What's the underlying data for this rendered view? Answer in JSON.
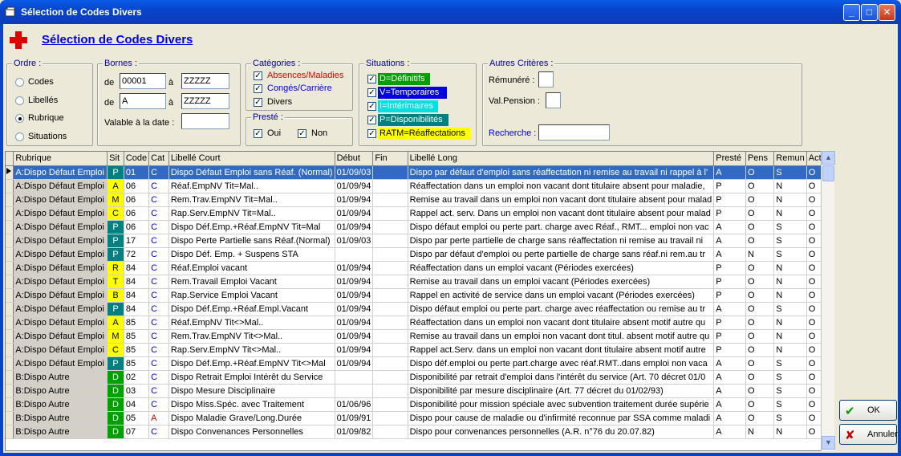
{
  "window": {
    "title": "Sélection de Codes Divers"
  },
  "header": {
    "title": "Sélection de Codes Divers"
  },
  "ordre": {
    "legend": "Ordre :",
    "options": [
      "Codes",
      "Libellés",
      "Rubrique",
      "Situations"
    ],
    "selected": "Rubrique"
  },
  "bornes": {
    "legend": "Bornes :",
    "de_label": "de",
    "a_label": "à",
    "row1_from": "00001",
    "row1_to": "ZZZZZ",
    "row2_from": "A",
    "row2_to": "ZZZZZ",
    "valable_label": "Valable à la date :",
    "valable_value": ""
  },
  "categories": {
    "legend": "Catégories :",
    "items": [
      {
        "label": "Absences/Maladies",
        "checked": true,
        "color": "#e00000"
      },
      {
        "label": "Congés/Carrière",
        "checked": true,
        "color": "#0000e0"
      },
      {
        "label": "Divers",
        "checked": true,
        "color": "#000000"
      }
    ]
  },
  "preste": {
    "legend": "Presté :",
    "items": [
      {
        "label": "Oui",
        "checked": true
      },
      {
        "label": "Non",
        "checked": true
      }
    ]
  },
  "situations": {
    "legend": "Situations :",
    "items": [
      {
        "label": "D=Définitifs",
        "checked": true,
        "bg": "#00a000",
        "fg": "#ffffff"
      },
      {
        "label": "V=Temporaires",
        "checked": true,
        "bg": "#0000e0",
        "fg": "#ffffff"
      },
      {
        "label": "I=Intérimaires",
        "checked": true,
        "bg": "#00e0e0",
        "fg": "#ffffff"
      },
      {
        "label": "P=Disponibilités",
        "checked": true,
        "bg": "#008080",
        "fg": "#ffffff"
      },
      {
        "label": "RATM=Réaffectations",
        "checked": true,
        "bg": "#ffff00",
        "fg": "#000000"
      }
    ]
  },
  "autres": {
    "legend": "Autres Critères :",
    "remunere_label": "Rémunéré :",
    "remunere_value": "",
    "pension_label": "Val.Pension :",
    "pension_value": "",
    "recherche_label": "Recherche :",
    "recherche_value": ""
  },
  "sit_colors": {
    "P": "#008080",
    "A": "#ffff00",
    "M": "#ffff00",
    "C": "#ffff00",
    "R": "#ffff00",
    "T": "#ffff00",
    "B": "#ffff00",
    "D": "#00a000"
  },
  "cat_colors": {
    "C": "#0000e0",
    "A": "#e00000"
  },
  "table": {
    "columns": [
      "Rubrique",
      "Sit",
      "Code",
      "Cat",
      "Libellé Court",
      "Début",
      "Fin",
      "Libellé Long",
      "Presté",
      "Pens",
      "Remun",
      "Actif"
    ],
    "rows": [
      [
        "A:Dispo Défaut Emploi",
        "P",
        "01",
        "C",
        "Dispo Défaut Emploi sans Réaf. (Normal)",
        "01/09/03",
        "",
        "Dispo par défaut d'emploi sans réaffectation ni remise au travail ni rappel à l'",
        "A",
        "O",
        "S",
        "O"
      ],
      [
        "A:Dispo Défaut Emploi",
        "A",
        "06",
        "C",
        "Réaf.EmpNV Tit=Mal..",
        "01/09/94",
        "",
        "Réaffectation dans un emploi non vacant dont titulaire absent pour maladie,",
        "P",
        "O",
        "N",
        "O"
      ],
      [
        "A:Dispo Défaut Emploi",
        "M",
        "06",
        "C",
        "Rem.Trav.EmpNV Tit=Mal..",
        "01/09/94",
        "",
        "Remise au travail dans un emploi non vacant dont titulaire absent pour malad",
        "P",
        "O",
        "N",
        "O"
      ],
      [
        "A:Dispo Défaut Emploi",
        "C",
        "06",
        "C",
        "Rap.Serv.EmpNV Tit=Mal..",
        "01/09/94",
        "",
        "Rappel act. serv. Dans un emploi non vacant dont titulaire absent pour malad",
        "P",
        "O",
        "N",
        "O"
      ],
      [
        "A:Dispo Défaut Emploi",
        "P",
        "06",
        "C",
        "Dispo Déf.Emp.+Réaf.EmpNV Tit=Mal",
        "01/09/94",
        "",
        "Dispo défaut emploi ou perte part. charge avec Réaf., RMT... emploi non vac",
        "A",
        "O",
        "S",
        "O"
      ],
      [
        "A:Dispo Défaut Emploi",
        "P",
        "17",
        "C",
        "Dispo Perte Partielle sans Réaf.(Normal)",
        "01/09/03",
        "",
        "Dispo par perte partielle de charge sans réaffectation ni remise au travail ni",
        "A",
        "O",
        "S",
        "O"
      ],
      [
        "A:Dispo Défaut Emploi",
        "P",
        "72",
        "C",
        "Dispo Déf. Emp. + Suspens STA",
        "",
        "",
        "Dispo par défaut d'emploi ou perte partielle de charge sans réaf.ni rem.au tr",
        "A",
        "N",
        "S",
        "O"
      ],
      [
        "A:Dispo Défaut Emploi",
        "R",
        "84",
        "C",
        "Réaf.Emploi vacant",
        "01/09/94",
        "",
        "Réaffectation dans un emploi vacant (Périodes exercées)",
        "P",
        "O",
        "N",
        "O"
      ],
      [
        "A:Dispo Défaut Emploi",
        "T",
        "84",
        "C",
        "Rem.Travail Emploi Vacant",
        "01/09/94",
        "",
        "Remise au travail dans un emploi vacant (Périodes exercées)",
        "P",
        "O",
        "N",
        "O"
      ],
      [
        "A:Dispo Défaut Emploi",
        "B",
        "84",
        "C",
        "Rap.Service Emploi Vacant",
        "01/09/94",
        "",
        "Rappel en activité de service dans un emploi vacant (Périodes exercées)",
        "P",
        "O",
        "N",
        "O"
      ],
      [
        "A:Dispo Défaut Emploi",
        "P",
        "84",
        "C",
        "Dispo Déf.Emp.+Réaf.Empl.Vacant",
        "01/09/94",
        "",
        "Dispo défaut emploi ou perte part. charge avec réaffectation ou remise au tr",
        "A",
        "O",
        "S",
        "O"
      ],
      [
        "A:Dispo Défaut Emploi",
        "A",
        "85",
        "C",
        "Réaf.EmpNV Tit<>Mal..",
        "01/09/94",
        "",
        "Réaffectation dans un emploi non vacant dont titulaire absent motif autre qu",
        "P",
        "O",
        "N",
        "O"
      ],
      [
        "A:Dispo Défaut Emploi",
        "M",
        "85",
        "C",
        "Rem.Trav.EmpNV Tit<>Mal..",
        "01/09/94",
        "",
        "Remise au travail dans un emploi non vacant dont titul. absent motif autre qu",
        "P",
        "O",
        "N",
        "O"
      ],
      [
        "A:Dispo Défaut Emploi",
        "C",
        "85",
        "C",
        "Rap.Serv.EmpNV Tit<>Mal..",
        "01/09/94",
        "",
        "Rappel act.Serv. dans un emploi non vacant dont titulaire absent motif autre",
        "P",
        "O",
        "N",
        "O"
      ],
      [
        "A:Dispo Défaut Emploi",
        "P",
        "85",
        "C",
        "Dispo Déf.Emp.+Réaf.EmpNV Tit<>Mal",
        "01/09/94",
        "",
        "Dispo déf.emploi ou perte part.charge avec réaf.RMT..dans emploi non vaca",
        "A",
        "O",
        "S",
        "O"
      ],
      [
        "B:Dispo Autre",
        "D",
        "02",
        "C",
        "Dispo Retrait Emploi Intérêt du Service",
        "",
        "",
        "Disponibilité par retrait d'emploi dans l'intérêt du service  (Art. 70 décret 01/0",
        "A",
        "O",
        "S",
        "O"
      ],
      [
        "B:Dispo Autre",
        "D",
        "03",
        "C",
        "Dispo Mesure Disciplinaire",
        "",
        "",
        "Disponibilité par mesure disciplinaire (Art. 77 décret du 01/02/93)",
        "A",
        "O",
        "S",
        "O"
      ],
      [
        "B:Dispo Autre",
        "D",
        "04",
        "C",
        "Dispo Miss.Spéc. avec Traitement",
        "01/06/96",
        "",
        "Disponibilité pour mission spéciale avec subvention traitement durée supérie",
        "A",
        "O",
        "S",
        "O"
      ],
      [
        "B:Dispo Autre",
        "D",
        "05",
        "A",
        "Dispo Maladie Grave/Long.Durée",
        "01/09/91",
        "",
        "Dispo pour cause de maladie ou d'infirmité reconnue par SSA comme maladi",
        "A",
        "O",
        "S",
        "O"
      ],
      [
        "B:Dispo Autre",
        "D",
        "07",
        "C",
        "Dispo Convenances Personnelles",
        "01/09/82",
        "",
        "Dispo pour convenances personnelles (A.R. n°76   du 20.07.82)",
        "A",
        "N",
        "N",
        "O"
      ]
    ]
  },
  "buttons": {
    "ok": "OK",
    "annuler": "Annuler"
  }
}
